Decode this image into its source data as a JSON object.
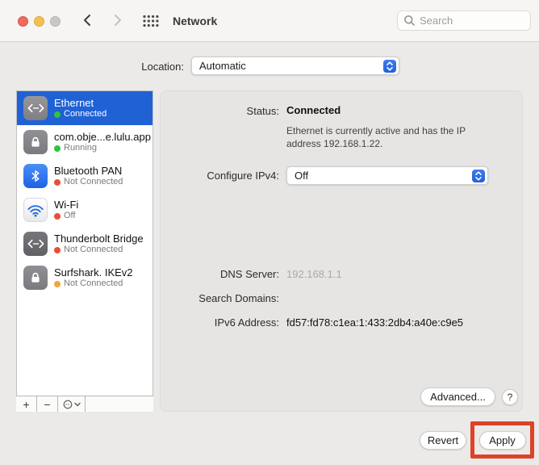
{
  "titlebar": {
    "title": "Network",
    "search_placeholder": "Search"
  },
  "location": {
    "label": "Location:",
    "value": "Automatic"
  },
  "sidebar": {
    "items": [
      {
        "name": "Ethernet",
        "status": "Connected",
        "dot_color": "green",
        "icon": "ethernet-icon",
        "selected": true
      },
      {
        "name": "com.obje...e.lulu.app",
        "status": "Running",
        "dot_color": "green",
        "icon": "lock-icon",
        "selected": false
      },
      {
        "name": "Bluetooth PAN",
        "status": "Not Connected",
        "dot_color": "red",
        "icon": "bluetooth-icon",
        "selected": false
      },
      {
        "name": "Wi-Fi",
        "status": "Off",
        "dot_color": "red",
        "icon": "wifi-icon",
        "selected": false
      },
      {
        "name": "Thunderbolt Bridge",
        "status": "Not Connected",
        "dot_color": "red",
        "icon": "ethernet-icon",
        "selected": false
      },
      {
        "name": "Surfshark. IKEv2",
        "status": "Not Connected",
        "dot_color": "orange",
        "icon": "lock-icon",
        "selected": false
      }
    ],
    "add_label": "+",
    "remove_label": "−"
  },
  "main": {
    "status_label": "Status:",
    "status_value": "Connected",
    "status_detail": "Ethernet is currently active and has the IP address 192.168.1.22.",
    "configure_label": "Configure IPv4:",
    "configure_value": "Off",
    "dns_label": "DNS Server:",
    "dns_value": "192.168.1.1",
    "search_domains_label": "Search Domains:",
    "search_domains_value": "",
    "ipv6_label": "IPv6 Address:",
    "ipv6_value": "fd57:fd78:c1ea:1:433:2db4:a40e:c9e5",
    "advanced_label": "Advanced...",
    "help_label": "?"
  },
  "footer": {
    "revert_label": "Revert",
    "apply_label": "Apply"
  },
  "colors": {
    "selection_blue": "#2061d5",
    "stepper_blue": "#2160d8",
    "status_green": "#2dc53d",
    "status_red": "#ed4d38",
    "status_orange": "#f1a63a",
    "annotation_red": "#dc4327",
    "traffic_red": "#ee6a5f",
    "traffic_yellow": "#f5bf4f",
    "traffic_gray": "#c8c8c6"
  }
}
